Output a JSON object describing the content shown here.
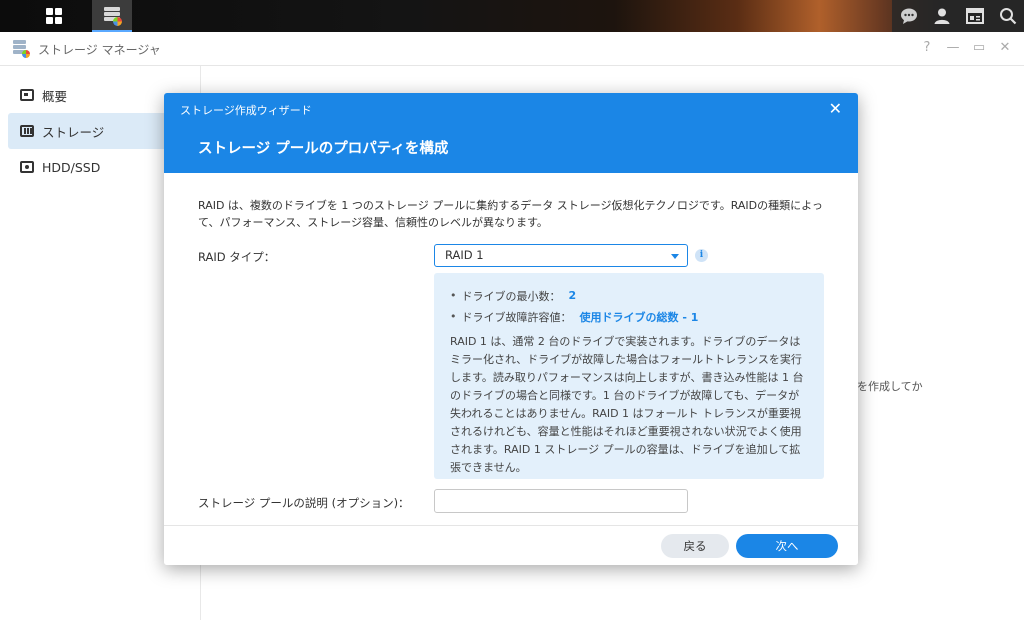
{
  "taskbar": {
    "main_menu_icon": "grid-icon",
    "app_icon": "storage-manager-icon",
    "right_icons": [
      "chat-icon",
      "user-icon",
      "widgets-icon",
      "search-icon"
    ]
  },
  "app": {
    "title": "ストレージ マネージャ",
    "controls": [
      "?",
      "—",
      "▭",
      "✕"
    ]
  },
  "sidebar": {
    "items": [
      {
        "label": "概要",
        "icon": "overview-icon"
      },
      {
        "label": "ストレージ",
        "icon": "storage-icon",
        "active": true
      },
      {
        "label": "HDD/SSD",
        "icon": "hdd-icon"
      }
    ]
  },
  "background": {
    "fragment_text": "を作成してか"
  },
  "dialog": {
    "window_title": "ストレージ作成ウィザード",
    "close_glyph": "✕",
    "heading": "ストレージ プールのプロパティを構成",
    "description": "RAID は、複数のドライブを 1 つのストレージ プールに集約するデータ ストレージ仮想化テクノロジです。RAIDの種類によって、パフォーマンス、ストレージ容量、信頼性のレベルが異なります。",
    "raid_type_label": "RAID タイプ：",
    "raid_type_value": "RAID 1",
    "info_glyph": "i",
    "info_box": {
      "min_drives_label": "ドライブの最小数：",
      "min_drives_value": "2",
      "fault_tolerance_label": "ドライブ故障許容値：",
      "fault_tolerance_value": "使用ドライブの総数 - 1",
      "body": "RAID 1 は、通常 2 台のドライブで実装されます。ドライブのデータはミラー化され、ドライブが故障した場合はフォールトトレランスを実行します。読み取りパフォーマンスは向上しますが、書き込み性能は 1 台のドライブの場合と同様です。1 台のドライブが故障しても、データが失われることはありません。RAID 1 はフォールト トレランスが重要視されるけれども、容量と性能はそれほど重要視されない状況でよく使用されます。RAID 1 ストレージ プールの容量は、ドライブを追加して拡張できません。"
    },
    "pool_description_label": "ストレージ プールの説明 (オプション)：",
    "pool_description_value": "",
    "back_button": "戻る",
    "next_button": "次へ"
  },
  "colors": {
    "accent": "#1b86e6",
    "info_box_bg": "#e3f0fb",
    "sidebar_active": "#dbeaf7"
  }
}
